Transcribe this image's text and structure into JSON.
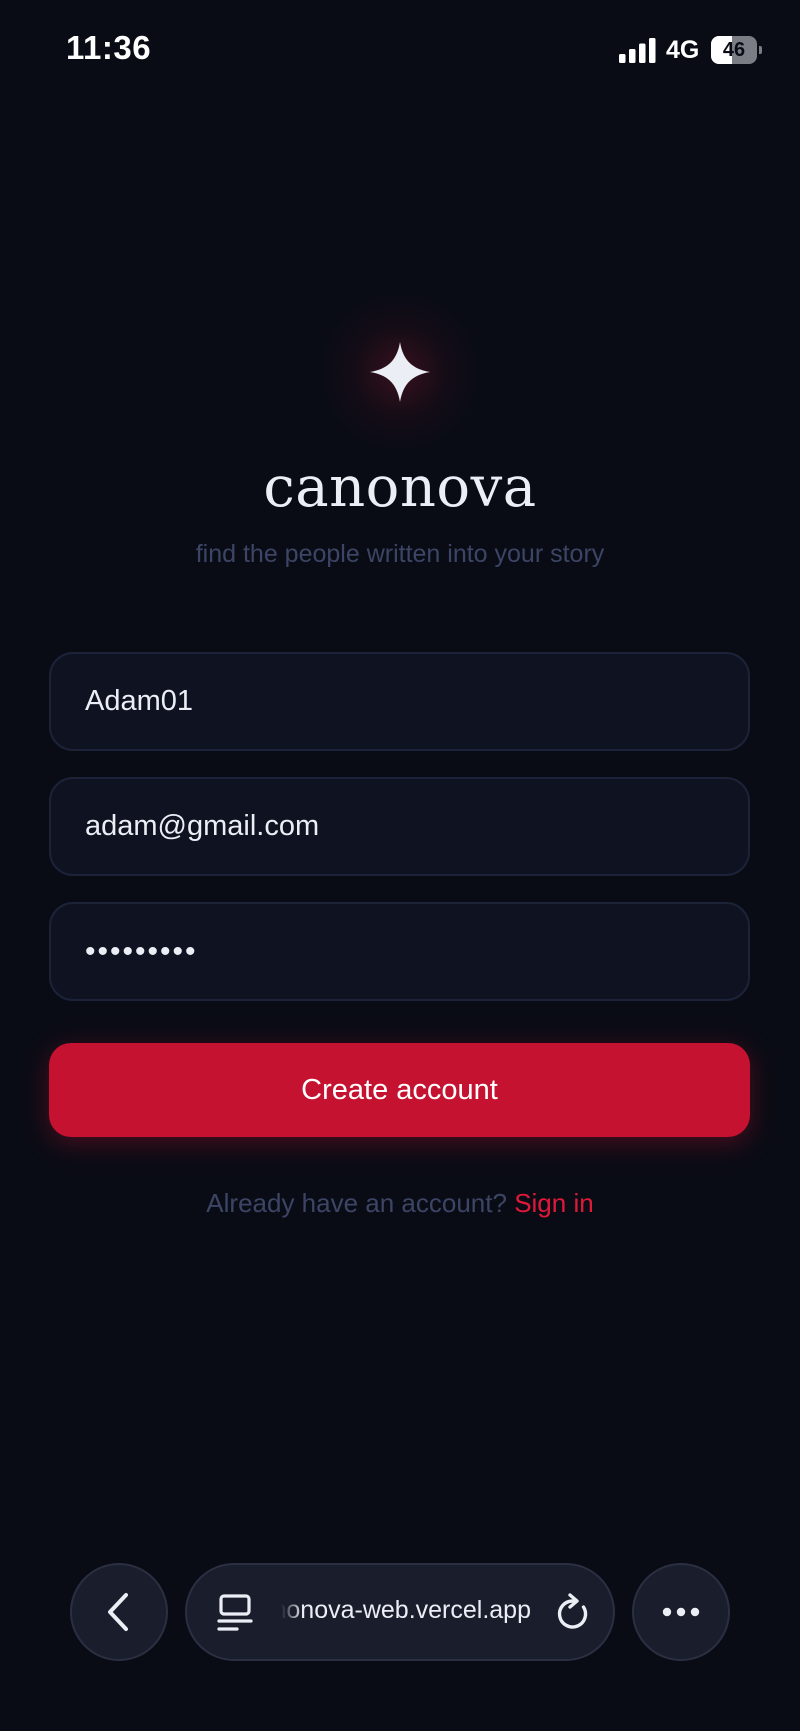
{
  "status_bar": {
    "time": "11:36",
    "network": "4G",
    "battery_percent": "46",
    "battery_level": 0.46,
    "signal_icon": "signal-bars-icon"
  },
  "brand": {
    "logo_icon": "sparkle-icon",
    "name": "canonova",
    "tagline": "find the people written into your story"
  },
  "form": {
    "username_value": "Adam01",
    "email_value": "adam@gmail.com",
    "password_value": "•••••••••",
    "submit_label": "Create account"
  },
  "signin": {
    "prompt": "Already have an account?",
    "link_label": "Sign in"
  },
  "browser_bar": {
    "back_icon": "chevron-left-icon",
    "tabs_icon": "tabs-icon",
    "url": "canonova-web.vercel.app",
    "reload_icon": "reload-icon",
    "more_icon": "more-dots-icon"
  },
  "colors": {
    "background": "#0a0c15",
    "accent": "#c41230",
    "link": "#e0193a",
    "muted_text": "#3c4565",
    "field_background": "#0f1220",
    "field_border": "#1c2338"
  }
}
